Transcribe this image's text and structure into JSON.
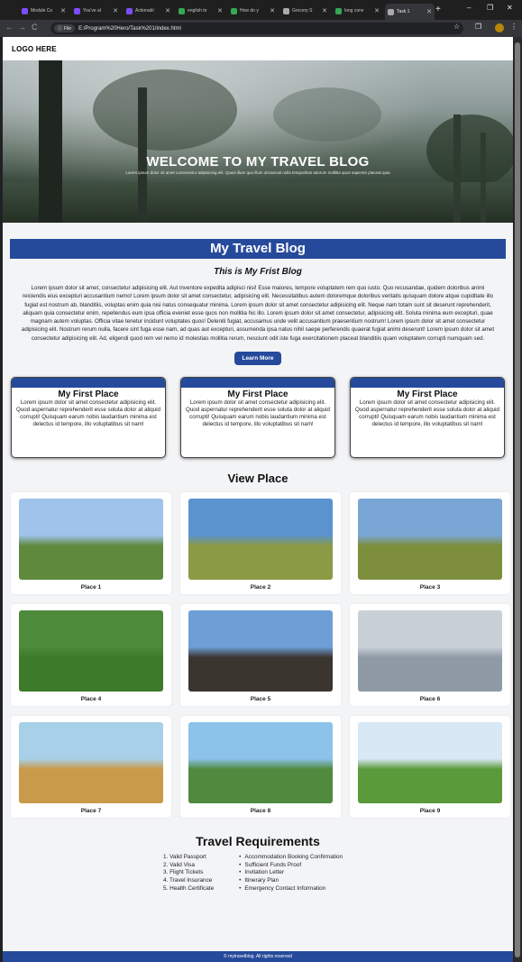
{
  "browser": {
    "tabs": [
      {
        "title": "Module Co",
        "favicon_color": "#7c4dff"
      },
      {
        "title": "You've al",
        "favicon_color": "#7c4dff"
      },
      {
        "title": "Actionabl",
        "favicon_color": "#7c4dff"
      },
      {
        "title": "english to",
        "favicon_color": "#34a853"
      },
      {
        "title": "How do y",
        "favicon_color": "#34a853"
      },
      {
        "title": "Grocery S",
        "favicon_color": "#aaaaaa"
      },
      {
        "title": "long conv",
        "favicon_color": "#34a853"
      },
      {
        "title": "Task 1",
        "favicon_color": "#aaaaaa"
      }
    ],
    "active_tab_index": 7,
    "close_glyph": "✕",
    "new_tab_glyph": "+",
    "back_glyph": "←",
    "forward_glyph": "→",
    "reload_glyph": "C",
    "site_info_label": "File",
    "url": "E:/Program%20Hero/Task%201/index.html",
    "star_glyph": "☆",
    "extensions_glyph": "❐",
    "menu_glyph": "⋮",
    "minimize_glyph": "–",
    "restore_glyph": "❐",
    "window_close_glyph": "✕"
  },
  "page": {
    "logo": "LOGO HERE",
    "hero": {
      "title": "WELCOME TO MY TRAVEL BLOG",
      "subtitle": "Lorem ipsum dolor sit amet consectetur adipisicing elit. Quasi illum quo illum obcaecati nulla temporibus iatorum mollitia quos sapiente placeat quia"
    },
    "blog": {
      "heading": "My Travel Blog",
      "subheading": "This is My Frist Blog",
      "body": "Lorem ipsum dolor sit amet, consectetur adipisicing elit. Aut inventore expedita adipisci nisi! Esse maiores, tempore voluptatem rem quo iusto. Quo recusandae, quidem doloribus animi reiciendis eius excepturi accusantium nemo! Lorem ipsum dolor sit amet consectetur, adipisicing elit. Necessitatibus autem doloremque doloribus veritatis quisquam dolore atque cupiditate illo fugiat est nostrum ab, blanditiis, voluptas enim quia nisi natus consequatur minima. Lorem ipsum dolor sit amet consectetur adipisicing elit. Neque nam totam sunt sit deserunt reprehenderit, aliquam quia consectetur enim, repellendus eum ipsa officia eveniet esse quos non mollitia hic illo. Lorem ipsum dolor sit amet consectetur, adipisicing elit. Soluta minima eum excepturi, quae magnam autem voluptas. Officia vitae tenetur incidunt voluptates quos! Deleniti fugiat, accusamus unde velit accusantium praesentium nostrum! Lorem ipsum dolor sit amet consectetur adipisicing elit. Nostrum rerum nulla, facere sint fuga esse nam, ad quas aut excepturi, assumenda ipsa natus nihil saepe perferendis quaerat fugiat animi deserunt! Lorem ipsum dolor sit amet consectetur adipisicing elit. Ad, eligendi quod rem vel nemo id molestias mollitia rerum, nesciunt odit iste fuga exercitationem placeat blanditiis quam voluptatem corrupti numquam sed.",
      "button_label": "Learn More"
    },
    "cards": [
      {
        "title": "My First Place",
        "text": "Lorem ipsum dolor sit amet consectetur adipisicing elit. Quod aspernatur reprehenderit esse soluta dolor at aliquid corrupti! Quisquam earum nobis laudantium minima est delectus id tempore, illo voluptatibus sit nam!"
      },
      {
        "title": "My First Place",
        "text": "Lorem ipsum dolor sit amet consectetur adipisicing elit. Quod aspernatur reprehenderit esse soluta dolor at aliquid corrupti! Quisquam earum nobis laudantium minima est delectus id tempore, illo voluptatibus sit nam!"
      },
      {
        "title": "My First Place",
        "text": "Lorem ipsum dolor sit amet consectetur adipisicing elit. Quod aspernatur reprehenderit esse soluta dolor at aliquid corrupti! Quisquam earum nobis laudantium minima est delectus id tempore, illo voluptatibus sit nam!"
      }
    ],
    "view_place": {
      "heading": "View Place",
      "places": [
        {
          "label": "Place 1",
          "sky": "#9fc3ea",
          "land": "#5f8a3e"
        },
        {
          "label": "Place 2",
          "sky": "#5b93cf",
          "land": "#8a9a45"
        },
        {
          "label": "Place 3",
          "sky": "#7aa6d6",
          "land": "#7d8f3c"
        },
        {
          "label": "Place 4",
          "sky": "#4d8a3a",
          "land": "#3d7a2a"
        },
        {
          "label": "Place 5",
          "sky": "#6d9fd6",
          "land": "#3b3530"
        },
        {
          "label": "Place 6",
          "sky": "#c9d1d8",
          "land": "#8f9aa6"
        },
        {
          "label": "Place 7",
          "sky": "#a8d0e8",
          "land": "#c99a4a"
        },
        {
          "label": "Place 8",
          "sky": "#8cc3ea",
          "land": "#4f8a3f"
        },
        {
          "label": "Place 9",
          "sky": "#d8e8f4",
          "land": "#5a9a3a"
        }
      ]
    },
    "requirements": {
      "heading": "Travel Requirements",
      "ordered": [
        "1. Valid Passport",
        "2. Valid Visa",
        "3. Flight Tickets",
        "4. Travel Insurance",
        "5. Health Certificate"
      ],
      "unordered": [
        "Accommodation Booking Confirmation",
        "Sufficient Funds Proof",
        "Invitation Letter",
        "Itinerary Plan",
        "Emergency Contact Information"
      ]
    },
    "footer": "© mytravelblog. All rights reserved",
    "accent_color": "#264a9b"
  }
}
